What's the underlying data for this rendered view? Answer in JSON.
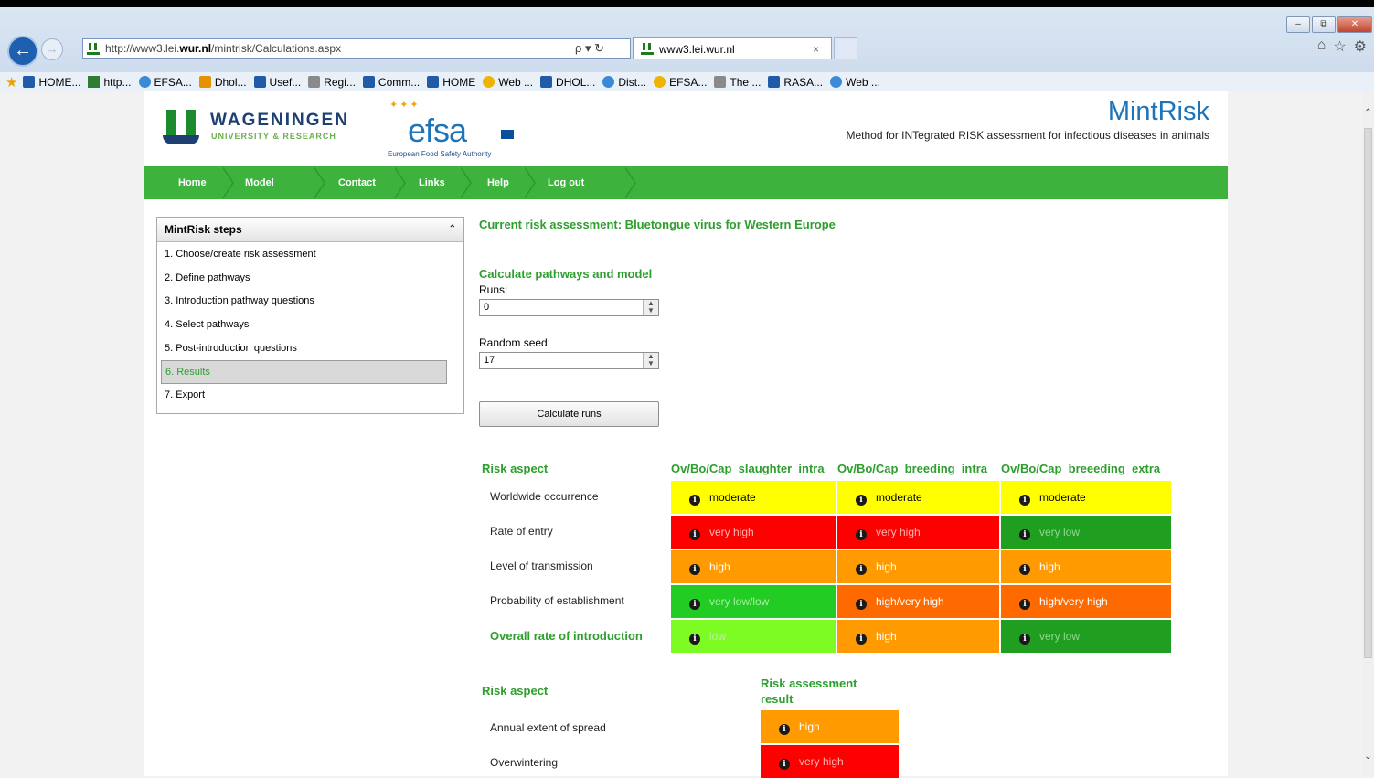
{
  "browser": {
    "url_prefix": "http://www3.lei.",
    "url_domain": "wur.nl",
    "url_path": "/mintrisk/Calculations.aspx",
    "search_tools": "ρ ▾ ↻",
    "tab_title": "www3.lei.wur.nl",
    "tab_close": "×",
    "favorites": [
      "HOME...",
      "http...",
      "EFSA...",
      "Dhol...",
      "Usef...",
      "Regi...",
      "Comm...",
      "HOME",
      "Web ...",
      "DHOL...",
      "Dist...",
      "EFSA...",
      "The ...",
      "RASA...",
      "Web ..."
    ],
    "favorite_icons": [
      "ms",
      "gr",
      "ie",
      "or",
      "ms",
      "gy",
      "ms",
      "ms",
      "ye",
      "ms",
      "ie",
      "ye",
      "gy",
      "ms",
      "ie"
    ]
  },
  "header": {
    "wur_line1": "WAGENINGEN",
    "wur_line2": "UNIVERSITY & RESEARCH",
    "efsa_word": "efsa",
    "efsa_sub": "European Food Safety Authority",
    "title": "MintRisk",
    "subtitle": "Method for INTegrated RISK assessment for infectious diseases in animals"
  },
  "menu": [
    "Home",
    "Model",
    "Contact",
    "Links",
    "Help",
    "Log out"
  ],
  "steps": {
    "heading": "MintRisk steps",
    "items": [
      "1. Choose/create risk assessment",
      "2. Define pathways",
      "3. Introduction pathway questions",
      "4. Select pathways",
      "5. Post-introduction questions",
      "6. Results",
      "7. Export"
    ],
    "active_index": 5
  },
  "main": {
    "current": "Current risk assessment: Bluetongue virus for Western Europe",
    "calc_title": "Calculate pathways and model",
    "runs_label": "Runs:",
    "runs_value": "0",
    "seed_label": "Random seed:",
    "seed_value": "17",
    "calc_button": "Calculate runs"
  },
  "colors": {
    "yellow": "#ffff00",
    "red": "#ff0000",
    "dark_green": "#1f9e1f",
    "orange": "#ff9a00",
    "green": "#22cc22",
    "orange_red": "#ff6a00",
    "light_green": "#7cfc22"
  },
  "table1": {
    "heading": "Risk aspect",
    "columns": [
      "Ov/Bo/Cap_slaughter_intra",
      "Ov/Bo/Cap_breeding_intra",
      "Ov/Bo/Cap_breeeding_extra"
    ],
    "rows": [
      {
        "label": "Worldwide occurrence",
        "cells": [
          [
            "moderate",
            "yellow",
            "#000"
          ],
          [
            "moderate",
            "yellow",
            "#000"
          ],
          [
            "moderate",
            "yellow",
            "#000"
          ]
        ]
      },
      {
        "label": "Rate of entry",
        "cells": [
          [
            "very high",
            "red",
            "#ffb3b3"
          ],
          [
            "very high",
            "red",
            "#ffb3b3"
          ],
          [
            "very low",
            "dark_green",
            "#8fd88f"
          ]
        ]
      },
      {
        "label": "Level of transmission",
        "cells": [
          [
            "high",
            "orange",
            "#fff"
          ],
          [
            "high",
            "orange",
            "#fff"
          ],
          [
            "high",
            "orange",
            "#fff"
          ]
        ]
      },
      {
        "label": "Probability of establishment",
        "cells": [
          [
            "very low/low",
            "green",
            "#a6f0a6"
          ],
          [
            "high/very high",
            "orange_red",
            "#fff"
          ],
          [
            "high/very high",
            "orange_red",
            "#fff"
          ]
        ]
      },
      {
        "label": "Overall rate of introduction",
        "overall": true,
        "cells": [
          [
            "low",
            "light_green",
            "#b9f39a"
          ],
          [
            "high",
            "orange",
            "#fff"
          ],
          [
            "very low",
            "dark_green",
            "#8fd88f"
          ]
        ]
      }
    ]
  },
  "table2": {
    "heading": "Risk aspect",
    "col_line1": "Risk assessment",
    "col_line2": "result",
    "rows": [
      {
        "label": "Annual extent of spread",
        "cells": [
          [
            "high",
            "orange",
            "#fff"
          ]
        ]
      },
      {
        "label": "Overwintering",
        "cells": [
          [
            "very high",
            "red",
            "#ffb3b3"
          ]
        ]
      }
    ]
  }
}
